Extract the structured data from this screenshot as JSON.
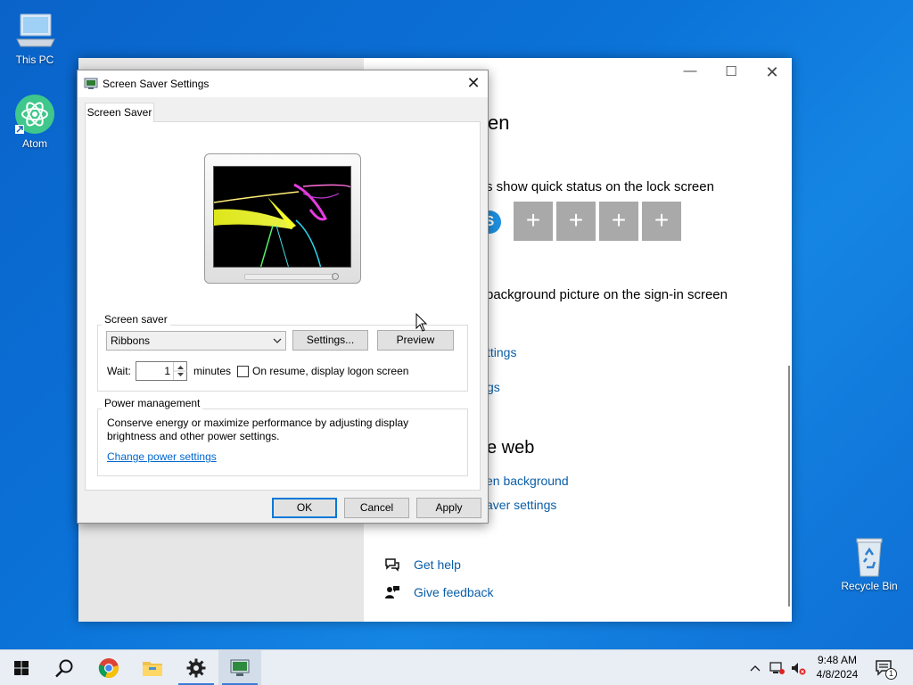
{
  "desktop": {
    "icons": [
      {
        "name": "this-pc",
        "label": "This PC"
      },
      {
        "name": "atom",
        "label": "Atom"
      },
      {
        "name": "recycle-bin",
        "label": "Recycle Bin"
      }
    ]
  },
  "settings_window": {
    "heading_partial": "en",
    "quick_status_text": "s show quick status on the lock screen",
    "background_picture_text": "background picture on the sign-in screen",
    "link_1_partial": "ttings",
    "link_2_partial": "gs",
    "web_heading_partial": "e web",
    "link_3_partial": "en background",
    "link_4_partial": "aver settings",
    "get_help": "Get help",
    "give_feedback": "Give feedback",
    "tile_plus": "+"
  },
  "dialog": {
    "title": "Screen Saver Settings",
    "tab": "Screen Saver",
    "screen_saver_group": "Screen saver",
    "selected_saver": "Ribbons",
    "settings_button": "Settings...",
    "preview_button": "Preview",
    "wait_label": "Wait:",
    "wait_value": "1",
    "minutes_label": "minutes",
    "resume_label": "On resume, display logon screen",
    "resume_checked": false,
    "power_group": "Power management",
    "power_text_1": "Conserve energy or maximize performance by adjusting display",
    "power_text_2": "brightness and other power settings.",
    "power_link": "Change power settings",
    "ok": "OK",
    "cancel": "Cancel",
    "apply": "Apply"
  },
  "taskbar": {
    "time": "9:48 AM",
    "date": "4/8/2024",
    "notification_count": "1"
  }
}
